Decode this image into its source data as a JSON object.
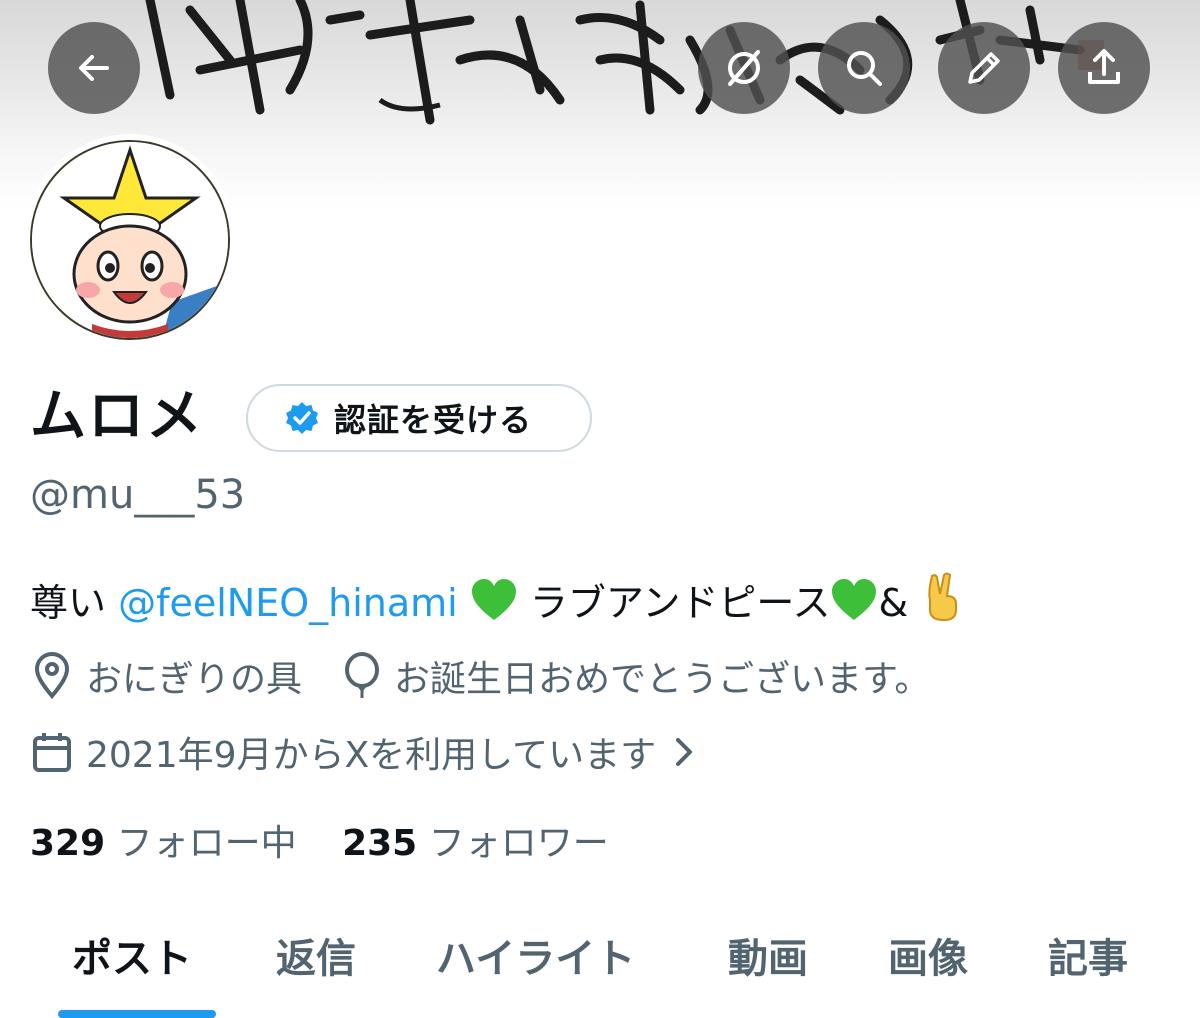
{
  "header": {
    "back_icon": "arrow-left-icon",
    "actions": [
      "circle-slash-icon",
      "search-icon",
      "pencil-icon",
      "share-icon"
    ]
  },
  "profile": {
    "display_name": "ムロメ",
    "verify_label": "認証を受ける",
    "handle": "@mu___53",
    "bio": {
      "prefix": "尊い ",
      "mention": "@feelNEO_hinami",
      "middle": " ラブアンドピース",
      "amp": "&"
    },
    "location": "おにぎりの具",
    "birthday": "お誕生日おめでとうございます。",
    "joined": "2021年9月からXを利用しています",
    "following_count": "329",
    "following_label": "フォロー中",
    "followers_count": "235",
    "followers_label": "フォロワー"
  },
  "tabs": [
    "ポスト",
    "返信",
    "ハイライト",
    "動画",
    "画像",
    "記事"
  ],
  "colors": {
    "accent": "#1d9bf0",
    "text": "#0f1419",
    "muted": "#536471",
    "heart": "#3dbf3a"
  }
}
